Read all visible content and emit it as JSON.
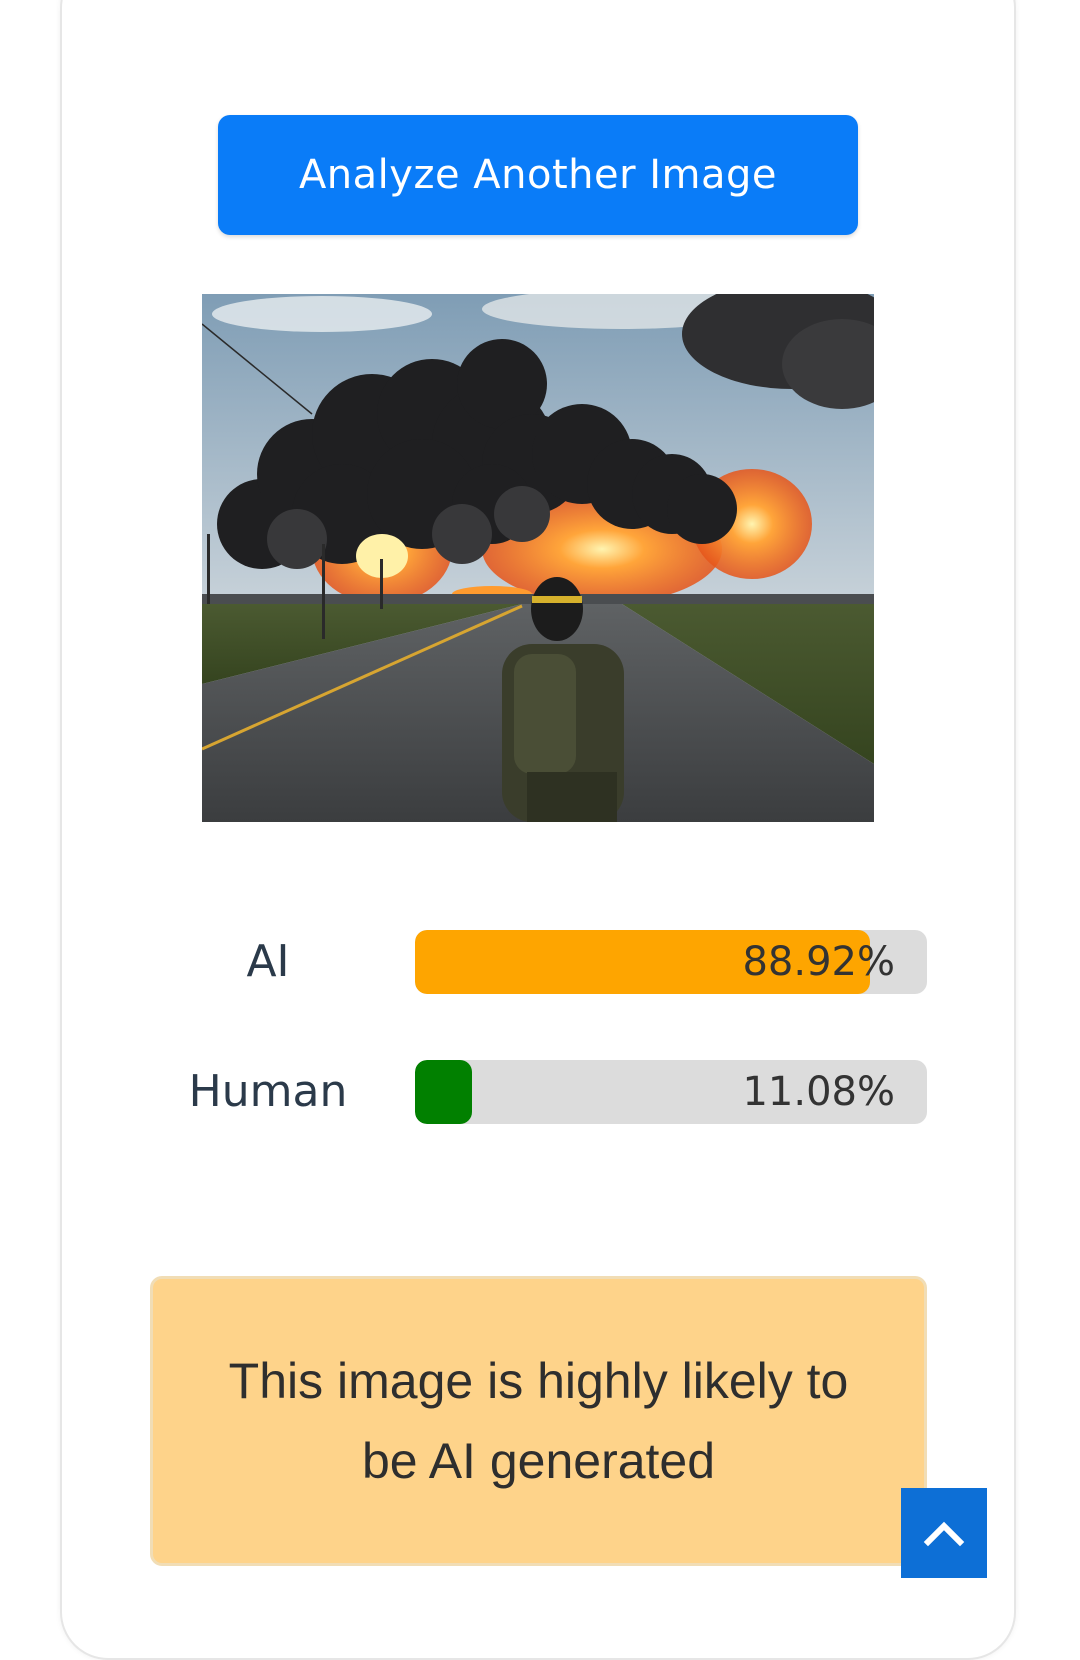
{
  "actions": {
    "analyze_label": "Analyze Another Image"
  },
  "image": {
    "alt": "Uploaded image"
  },
  "results": [
    {
      "label": "AI",
      "value_text": "88.92%",
      "percent": 88.92,
      "color": "#fea500"
    },
    {
      "label": "Human",
      "value_text": "11.08%",
      "percent": 11.08,
      "color": "#018000"
    }
  ],
  "verdict": {
    "text": "This image is highly likely to be AI generated"
  },
  "scroll_top": {
    "icon": "chevron-up-icon"
  }
}
